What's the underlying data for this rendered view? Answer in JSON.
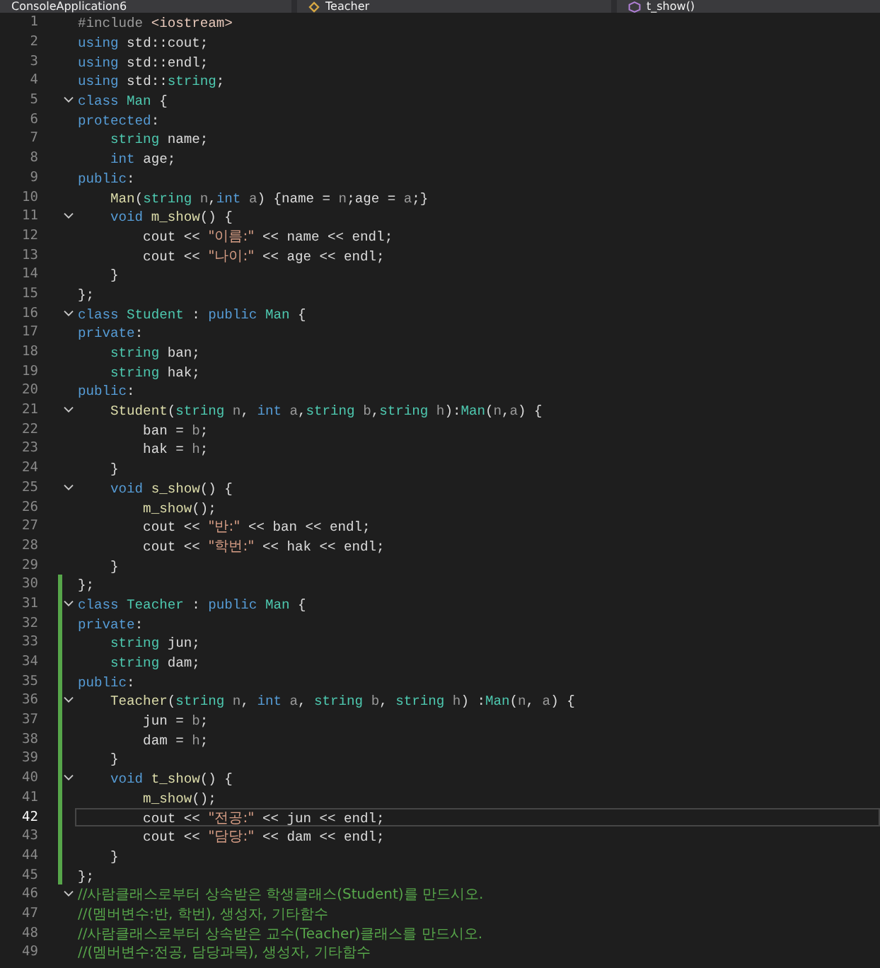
{
  "navigation_bar": {
    "project": "ConsoleApplication6",
    "scope": "Teacher",
    "member": "t_show()"
  },
  "lines": [
    {
      "number": "1",
      "foldable": false,
      "changed": false,
      "current": false,
      "tokens": [
        {
          "kind": "preproc",
          "text": "#include "
        },
        {
          "kind": "include",
          "text": "<iostream>"
        }
      ]
    },
    {
      "number": "2",
      "foldable": false,
      "changed": false,
      "current": false,
      "tokens": [
        {
          "kind": "keyword",
          "text": "using"
        },
        {
          "kind": "plain",
          "text": " std::cout;"
        }
      ]
    },
    {
      "number": "3",
      "foldable": false,
      "changed": false,
      "current": false,
      "tokens": [
        {
          "kind": "keyword",
          "text": "using"
        },
        {
          "kind": "plain",
          "text": " std::endl;"
        }
      ]
    },
    {
      "number": "4",
      "foldable": false,
      "changed": false,
      "current": false,
      "tokens": [
        {
          "kind": "keyword",
          "text": "using"
        },
        {
          "kind": "plain",
          "text": " std::"
        },
        {
          "kind": "type",
          "text": "string"
        },
        {
          "kind": "plain",
          "text": ";"
        }
      ]
    },
    {
      "number": "5",
      "foldable": true,
      "changed": false,
      "current": false,
      "tokens": [
        {
          "kind": "keyword",
          "text": "class "
        },
        {
          "kind": "type",
          "text": "Man"
        },
        {
          "kind": "plain",
          "text": " {"
        }
      ]
    },
    {
      "number": "6",
      "foldable": false,
      "changed": false,
      "current": false,
      "tokens": [
        {
          "kind": "keyword",
          "text": "protected"
        },
        {
          "kind": "plain",
          "text": ":"
        }
      ]
    },
    {
      "number": "7",
      "foldable": false,
      "changed": false,
      "current": false,
      "tokens": [
        {
          "kind": "type",
          "text": "    string"
        },
        {
          "kind": "plain",
          "text": " name;"
        }
      ]
    },
    {
      "number": "8",
      "foldable": false,
      "changed": false,
      "current": false,
      "tokens": [
        {
          "kind": "keyword",
          "text": "    int"
        },
        {
          "kind": "plain",
          "text": " age;"
        }
      ]
    },
    {
      "number": "9",
      "foldable": false,
      "changed": false,
      "current": false,
      "tokens": [
        {
          "kind": "keyword",
          "text": "public"
        },
        {
          "kind": "plain",
          "text": ":"
        }
      ]
    },
    {
      "number": "10",
      "foldable": false,
      "changed": false,
      "current": false,
      "tokens": [
        {
          "kind": "function",
          "text": "    Man"
        },
        {
          "kind": "plain",
          "text": "("
        },
        {
          "kind": "type",
          "text": "string "
        },
        {
          "kind": "param",
          "text": "n"
        },
        {
          "kind": "plain",
          "text": ","
        },
        {
          "kind": "keyword",
          "text": "int "
        },
        {
          "kind": "param",
          "text": "a"
        },
        {
          "kind": "plain",
          "text": ") {name = "
        },
        {
          "kind": "param",
          "text": "n"
        },
        {
          "kind": "plain",
          "text": ";age = "
        },
        {
          "kind": "param",
          "text": "a"
        },
        {
          "kind": "plain",
          "text": ";}"
        }
      ]
    },
    {
      "number": "11",
      "foldable": true,
      "changed": false,
      "current": false,
      "tokens": [
        {
          "kind": "keyword",
          "text": "    void "
        },
        {
          "kind": "function",
          "text": "m_show"
        },
        {
          "kind": "plain",
          "text": "() {"
        }
      ]
    },
    {
      "number": "12",
      "foldable": false,
      "changed": false,
      "current": false,
      "tokens": [
        {
          "kind": "plain",
          "text": "        cout << "
        },
        {
          "kind": "string",
          "text": "\"이름:\""
        },
        {
          "kind": "plain",
          "text": " << name << endl;"
        }
      ]
    },
    {
      "number": "13",
      "foldable": false,
      "changed": false,
      "current": false,
      "tokens": [
        {
          "kind": "plain",
          "text": "        cout << "
        },
        {
          "kind": "string",
          "text": "\"나이:\""
        },
        {
          "kind": "plain",
          "text": " << age << endl;"
        }
      ]
    },
    {
      "number": "14",
      "foldable": false,
      "changed": false,
      "current": false,
      "tokens": [
        {
          "kind": "plain",
          "text": "    }"
        }
      ]
    },
    {
      "number": "15",
      "foldable": false,
      "changed": false,
      "current": false,
      "tokens": [
        {
          "kind": "plain",
          "text": "};"
        }
      ]
    },
    {
      "number": "16",
      "foldable": true,
      "changed": false,
      "current": false,
      "tokens": [
        {
          "kind": "keyword",
          "text": "class "
        },
        {
          "kind": "type",
          "text": "Student"
        },
        {
          "kind": "plain",
          "text": " : "
        },
        {
          "kind": "keyword",
          "text": "public "
        },
        {
          "kind": "type",
          "text": "Man"
        },
        {
          "kind": "plain",
          "text": " {"
        }
      ]
    },
    {
      "number": "17",
      "foldable": false,
      "changed": false,
      "current": false,
      "tokens": [
        {
          "kind": "keyword",
          "text": "private"
        },
        {
          "kind": "plain",
          "text": ":"
        }
      ]
    },
    {
      "number": "18",
      "foldable": false,
      "changed": false,
      "current": false,
      "tokens": [
        {
          "kind": "type",
          "text": "    string"
        },
        {
          "kind": "plain",
          "text": " ban;"
        }
      ]
    },
    {
      "number": "19",
      "foldable": false,
      "changed": false,
      "current": false,
      "tokens": [
        {
          "kind": "type",
          "text": "    string"
        },
        {
          "kind": "plain",
          "text": " hak;"
        }
      ]
    },
    {
      "number": "20",
      "foldable": false,
      "changed": false,
      "current": false,
      "tokens": [
        {
          "kind": "keyword",
          "text": "public"
        },
        {
          "kind": "plain",
          "text": ":"
        }
      ]
    },
    {
      "number": "21",
      "foldable": true,
      "changed": false,
      "current": false,
      "tokens": [
        {
          "kind": "function",
          "text": "    Student"
        },
        {
          "kind": "plain",
          "text": "("
        },
        {
          "kind": "type",
          "text": "string "
        },
        {
          "kind": "param",
          "text": "n"
        },
        {
          "kind": "plain",
          "text": ", "
        },
        {
          "kind": "keyword",
          "text": "int "
        },
        {
          "kind": "param",
          "text": "a"
        },
        {
          "kind": "plain",
          "text": ","
        },
        {
          "kind": "type",
          "text": "string "
        },
        {
          "kind": "param",
          "text": "b"
        },
        {
          "kind": "plain",
          "text": ","
        },
        {
          "kind": "type",
          "text": "string "
        },
        {
          "kind": "param",
          "text": "h"
        },
        {
          "kind": "plain",
          "text": "):"
        },
        {
          "kind": "type",
          "text": "Man"
        },
        {
          "kind": "plain",
          "text": "("
        },
        {
          "kind": "param",
          "text": "n"
        },
        {
          "kind": "plain",
          "text": ","
        },
        {
          "kind": "param",
          "text": "a"
        },
        {
          "kind": "plain",
          "text": ") {"
        }
      ]
    },
    {
      "number": "22",
      "foldable": false,
      "changed": false,
      "current": false,
      "tokens": [
        {
          "kind": "plain",
          "text": "        ban = "
        },
        {
          "kind": "param",
          "text": "b"
        },
        {
          "kind": "plain",
          "text": ";"
        }
      ]
    },
    {
      "number": "23",
      "foldable": false,
      "changed": false,
      "current": false,
      "tokens": [
        {
          "kind": "plain",
          "text": "        hak = "
        },
        {
          "kind": "param",
          "text": "h"
        },
        {
          "kind": "plain",
          "text": ";"
        }
      ]
    },
    {
      "number": "24",
      "foldable": false,
      "changed": false,
      "current": false,
      "tokens": [
        {
          "kind": "plain",
          "text": "    }"
        }
      ]
    },
    {
      "number": "25",
      "foldable": true,
      "changed": false,
      "current": false,
      "tokens": [
        {
          "kind": "keyword",
          "text": "    void "
        },
        {
          "kind": "function",
          "text": "s_show"
        },
        {
          "kind": "plain",
          "text": "() {"
        }
      ]
    },
    {
      "number": "26",
      "foldable": false,
      "changed": false,
      "current": false,
      "tokens": [
        {
          "kind": "function",
          "text": "        m_show"
        },
        {
          "kind": "plain",
          "text": "();"
        }
      ]
    },
    {
      "number": "27",
      "foldable": false,
      "changed": false,
      "current": false,
      "tokens": [
        {
          "kind": "plain",
          "text": "        cout << "
        },
        {
          "kind": "string",
          "text": "\"반:\""
        },
        {
          "kind": "plain",
          "text": " << ban << endl;"
        }
      ]
    },
    {
      "number": "28",
      "foldable": false,
      "changed": false,
      "current": false,
      "tokens": [
        {
          "kind": "plain",
          "text": "        cout << "
        },
        {
          "kind": "string",
          "text": "\"학번:\""
        },
        {
          "kind": "plain",
          "text": " << hak << endl;"
        }
      ]
    },
    {
      "number": "29",
      "foldable": false,
      "changed": false,
      "current": false,
      "tokens": [
        {
          "kind": "plain",
          "text": "    }"
        }
      ]
    },
    {
      "number": "30",
      "foldable": false,
      "changed": true,
      "current": false,
      "tokens": [
        {
          "kind": "plain",
          "text": "};"
        }
      ]
    },
    {
      "number": "31",
      "foldable": true,
      "changed": true,
      "current": false,
      "tokens": [
        {
          "kind": "keyword",
          "text": "class "
        },
        {
          "kind": "type",
          "text": "Teacher"
        },
        {
          "kind": "plain",
          "text": " : "
        },
        {
          "kind": "keyword",
          "text": "public "
        },
        {
          "kind": "type",
          "text": "Man"
        },
        {
          "kind": "plain",
          "text": " {"
        }
      ]
    },
    {
      "number": "32",
      "foldable": false,
      "changed": true,
      "current": false,
      "tokens": [
        {
          "kind": "keyword",
          "text": "private"
        },
        {
          "kind": "plain",
          "text": ":"
        }
      ]
    },
    {
      "number": "33",
      "foldable": false,
      "changed": true,
      "current": false,
      "tokens": [
        {
          "kind": "type",
          "text": "    string"
        },
        {
          "kind": "plain",
          "text": " jun;"
        }
      ]
    },
    {
      "number": "34",
      "foldable": false,
      "changed": true,
      "current": false,
      "tokens": [
        {
          "kind": "type",
          "text": "    string"
        },
        {
          "kind": "plain",
          "text": " dam;"
        }
      ]
    },
    {
      "number": "35",
      "foldable": false,
      "changed": true,
      "current": false,
      "tokens": [
        {
          "kind": "keyword",
          "text": "public"
        },
        {
          "kind": "plain",
          "text": ":"
        }
      ]
    },
    {
      "number": "36",
      "foldable": true,
      "changed": true,
      "current": false,
      "tokens": [
        {
          "kind": "function",
          "text": "    Teacher"
        },
        {
          "kind": "plain",
          "text": "("
        },
        {
          "kind": "type",
          "text": "string "
        },
        {
          "kind": "param",
          "text": "n"
        },
        {
          "kind": "plain",
          "text": ", "
        },
        {
          "kind": "keyword",
          "text": "int "
        },
        {
          "kind": "param",
          "text": "a"
        },
        {
          "kind": "plain",
          "text": ", "
        },
        {
          "kind": "type",
          "text": "string "
        },
        {
          "kind": "param",
          "text": "b"
        },
        {
          "kind": "plain",
          "text": ", "
        },
        {
          "kind": "type",
          "text": "string "
        },
        {
          "kind": "param",
          "text": "h"
        },
        {
          "kind": "plain",
          "text": ") :"
        },
        {
          "kind": "type",
          "text": "Man"
        },
        {
          "kind": "plain",
          "text": "("
        },
        {
          "kind": "param",
          "text": "n"
        },
        {
          "kind": "plain",
          "text": ", "
        },
        {
          "kind": "param",
          "text": "a"
        },
        {
          "kind": "plain",
          "text": ") {"
        }
      ]
    },
    {
      "number": "37",
      "foldable": false,
      "changed": true,
      "current": false,
      "tokens": [
        {
          "kind": "plain",
          "text": "        jun = "
        },
        {
          "kind": "param",
          "text": "b"
        },
        {
          "kind": "plain",
          "text": ";"
        }
      ]
    },
    {
      "number": "38",
      "foldable": false,
      "changed": true,
      "current": false,
      "tokens": [
        {
          "kind": "plain",
          "text": "        dam = "
        },
        {
          "kind": "param",
          "text": "h"
        },
        {
          "kind": "plain",
          "text": ";"
        }
      ]
    },
    {
      "number": "39",
      "foldable": false,
      "changed": true,
      "current": false,
      "tokens": [
        {
          "kind": "plain",
          "text": "    }"
        }
      ]
    },
    {
      "number": "40",
      "foldable": true,
      "changed": true,
      "current": false,
      "tokens": [
        {
          "kind": "keyword",
          "text": "    void "
        },
        {
          "kind": "function",
          "text": "t_show"
        },
        {
          "kind": "plain",
          "text": "() {"
        }
      ]
    },
    {
      "number": "41",
      "foldable": false,
      "changed": true,
      "current": false,
      "tokens": [
        {
          "kind": "function",
          "text": "        m_show"
        },
        {
          "kind": "plain",
          "text": "();"
        }
      ]
    },
    {
      "number": "42",
      "foldable": false,
      "changed": true,
      "current": true,
      "tokens": [
        {
          "kind": "plain",
          "text": "        cout << "
        },
        {
          "kind": "string",
          "text": "\"전공:\""
        },
        {
          "kind": "plain",
          "text": " << jun << endl;"
        }
      ]
    },
    {
      "number": "43",
      "foldable": false,
      "changed": true,
      "current": false,
      "tokens": [
        {
          "kind": "plain",
          "text": "        cout << "
        },
        {
          "kind": "string",
          "text": "\"담당:\""
        },
        {
          "kind": "plain",
          "text": " << dam << endl;"
        }
      ]
    },
    {
      "number": "44",
      "foldable": false,
      "changed": true,
      "current": false,
      "tokens": [
        {
          "kind": "plain",
          "text": "    }"
        }
      ]
    },
    {
      "number": "45",
      "foldable": false,
      "changed": true,
      "current": false,
      "tokens": [
        {
          "kind": "plain",
          "text": "};"
        }
      ]
    },
    {
      "number": "46",
      "foldable": true,
      "changed": false,
      "current": false,
      "tokens": [
        {
          "kind": "comment",
          "text": "//사람클래스로부터 상속받은 학생클래스(Student)를 만드시오."
        }
      ]
    },
    {
      "number": "47",
      "foldable": false,
      "changed": false,
      "current": false,
      "tokens": [
        {
          "kind": "comment",
          "text": "//(멤버변수:반, 학번), 생성자, 기타함수"
        }
      ]
    },
    {
      "number": "48",
      "foldable": false,
      "changed": false,
      "current": false,
      "tokens": [
        {
          "kind": "comment",
          "text": "//사람클래스로부터 상속받은 교수(Teacher)클래스를 만드시오."
        }
      ]
    },
    {
      "number": "49",
      "foldable": false,
      "changed": false,
      "current": false,
      "tokens": [
        {
          "kind": "comment",
          "text": "//(멤버변수:전공, 담당과목), 생성자, 기타함수"
        }
      ]
    }
  ]
}
